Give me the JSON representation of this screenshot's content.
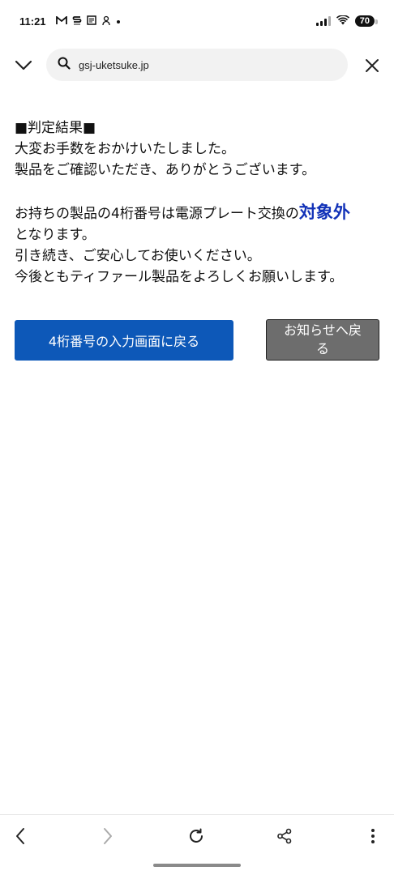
{
  "status_bar": {
    "time": "11:21",
    "left_icons": [
      "gmail-icon",
      "s-icon",
      "news-icon",
      "app-icon",
      "dot-icon"
    ],
    "battery": "70"
  },
  "url_bar": {
    "url": "gsj-uketsuke.jp"
  },
  "content": {
    "heading": "■判定結果■",
    "line1": "大変お手数をおかけいたしました。",
    "line2": "製品をご確認いただき、ありがとうございます。",
    "line3_prefix": "お持ちの製品の4桁番号は電源プレート交換の",
    "line3_emphasis": "対象外",
    "line4": "となります。",
    "line5": "引き続き、ご安心してお使いください。",
    "line6": "今後ともティファール製品をよろしくお願いします。",
    "emphasis_color": "#1232b8"
  },
  "buttons": {
    "primary_label": "4桁番号の入力画面に戻る",
    "secondary_label_line1": "お知らせへ戻",
    "secondary_label_line2": "る",
    "primary_color": "#0d58b8",
    "secondary_color": "#6d6d6d"
  },
  "bottom_nav": {
    "items": [
      "back-icon",
      "forward-icon",
      "reload-icon",
      "share-icon",
      "more-icon"
    ]
  }
}
